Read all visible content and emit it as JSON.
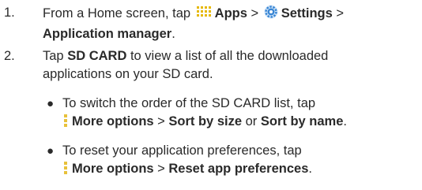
{
  "steps": [
    {
      "number": "1.",
      "line1": {
        "t1": "From a Home screen, tap ",
        "apps_icon": "apps-grid-icon",
        "apps": "Apps",
        "sep1": " > ",
        "settings_icon": "settings-gear-icon",
        "settings": "Settings",
        "sep2": " >"
      },
      "line2": {
        "app_manager": "Application manager",
        "t2": "."
      }
    },
    {
      "number": "2.",
      "line1": {
        "t1": "Tap ",
        "sd_card": "SD CARD",
        "t2": " to view a list of all the downloaded"
      },
      "line2": {
        "t1": "applications on your SD card."
      }
    }
  ],
  "bullets": [
    {
      "dot": "●",
      "line1": {
        "t1": "To switch the order of the SD CARD list, tap"
      },
      "line2": {
        "icon": "more-options-icon",
        "more_options": "More options",
        "sep": " > ",
        "sort_size": "Sort by size",
        "or": " or ",
        "sort_name": "Sort by name",
        "end": "."
      }
    },
    {
      "dot": "●",
      "line1": {
        "t1": "To reset your application preferences, tap"
      },
      "line2": {
        "icon": "more-options-icon",
        "more_options": "More options",
        "sep": " > ",
        "reset": "Reset app preferences",
        "end": "."
      }
    }
  ],
  "colors": {
    "text": "#2a2a2a",
    "apps_icon": "#e6b800",
    "settings_icon": "#3a86d4",
    "more_options_icon": "#e8c13a"
  }
}
